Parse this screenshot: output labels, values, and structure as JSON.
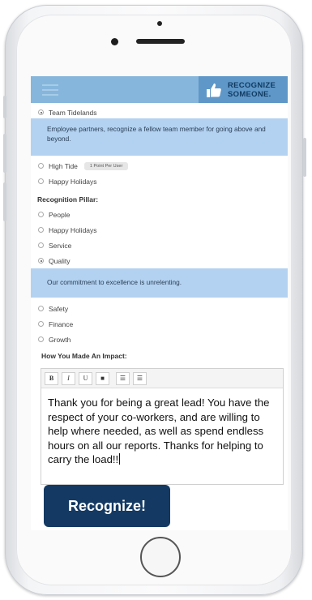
{
  "header": {
    "menu_icon": "hamburger-icon",
    "badge_icon": "thumbs-up-icon",
    "badge_line1": "RECOGNIZE",
    "badge_line2": "SOMEONE."
  },
  "programs": {
    "team": {
      "label": "Team Tidelands",
      "selected": true
    },
    "team_description": "Employee partners, recognize a fellow team member for going above and beyond.",
    "high_tide": {
      "label": "High Tide",
      "tag": "1 Point Per User",
      "selected": false
    },
    "happy_holidays": {
      "label": "Happy Holidays",
      "selected": false
    }
  },
  "pillar": {
    "heading": "Recognition Pillar:",
    "options": [
      {
        "label": "People",
        "selected": false
      },
      {
        "label": "Happy Holidays",
        "selected": false
      },
      {
        "label": "Service",
        "selected": false
      },
      {
        "label": "Quality",
        "selected": true
      }
    ],
    "quality_description": "Our commitment to excellence is unrelenting.",
    "more_options": [
      {
        "label": "Safety",
        "selected": false
      },
      {
        "label": "Finance",
        "selected": false
      },
      {
        "label": "Growth",
        "selected": false
      }
    ]
  },
  "impact": {
    "heading": "How You Made An Impact:",
    "toolbar": [
      "B",
      "I",
      "U",
      "■",
      "☰",
      "☰"
    ],
    "text": "Thank you for being a great lead! You have the respect of your co-workers, and are willing to help where needed, as well as spend endless hours on all our reports. Thanks for helping to carry the load!!"
  },
  "submit": {
    "label": "Recognize!"
  },
  "colors": {
    "topbar": "#86b6dc",
    "badge": "#5e97c8",
    "description_bg": "#b3d2f1",
    "button": "#143a63"
  }
}
